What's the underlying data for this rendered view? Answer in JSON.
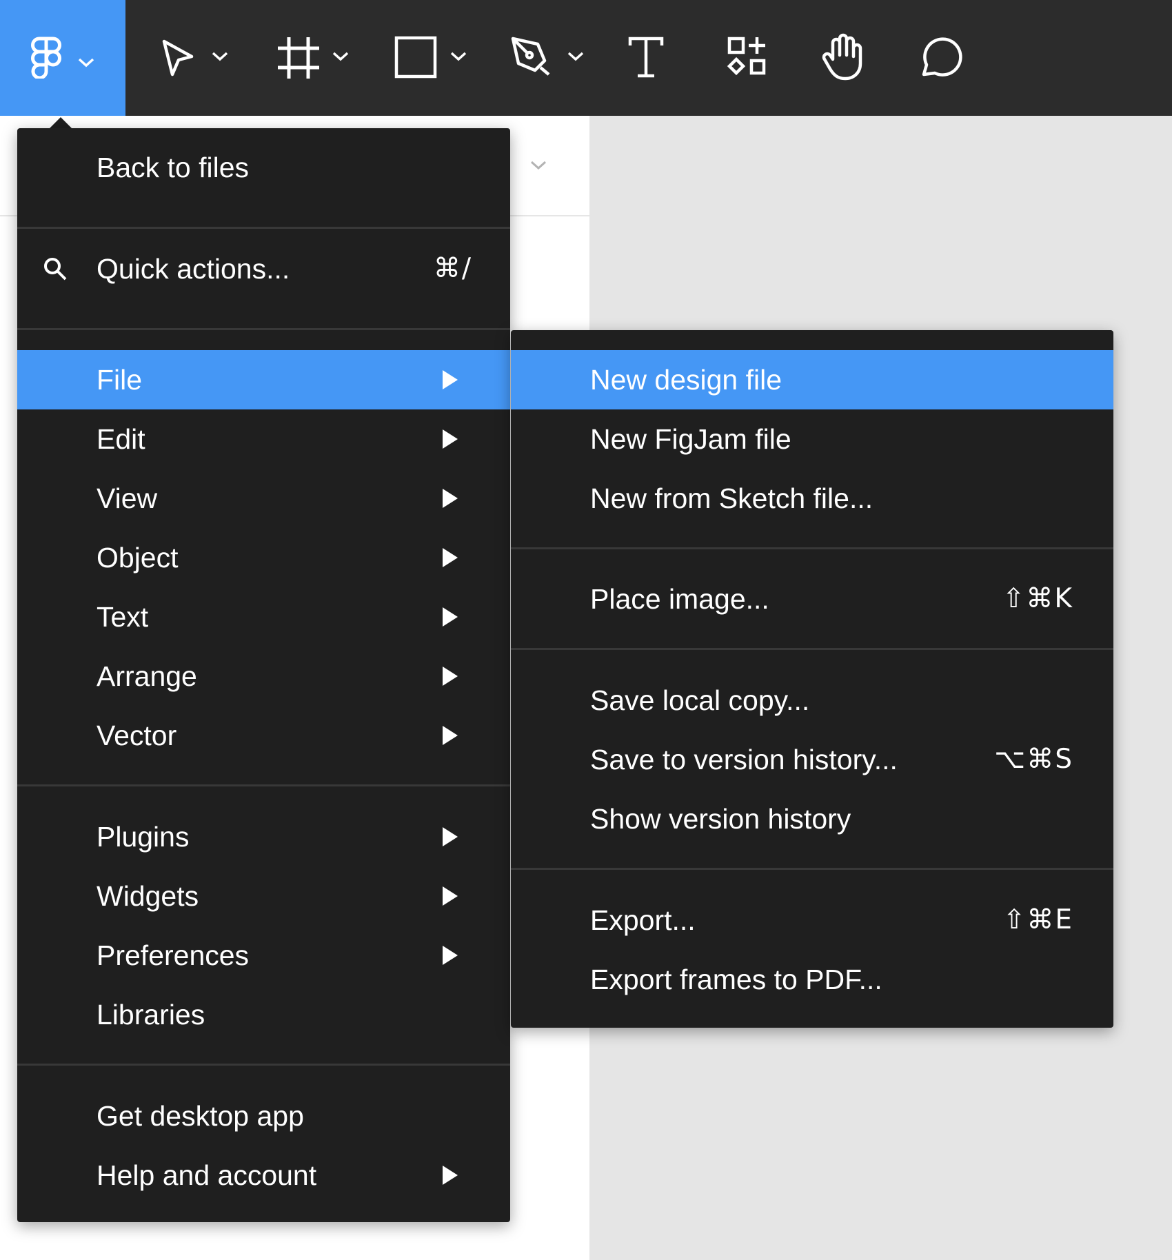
{
  "toolbar": {
    "tools": [
      {
        "icon": "figma-logo-icon",
        "has_dropdown": true,
        "active": true
      },
      {
        "icon": "move-tool-icon",
        "has_dropdown": true
      },
      {
        "icon": "frame-tool-icon",
        "has_dropdown": true
      },
      {
        "icon": "rectangle-tool-icon",
        "has_dropdown": true
      },
      {
        "icon": "pen-tool-icon",
        "has_dropdown": true
      },
      {
        "icon": "text-tool-icon"
      },
      {
        "icon": "resources-icon"
      },
      {
        "icon": "hand-tool-icon"
      },
      {
        "icon": "comment-tool-icon"
      }
    ]
  },
  "colors": {
    "toolbar_bg": "#2c2c2c",
    "accent": "#4597f5",
    "menu_bg": "#1f1f1f",
    "canvas_bg": "#e5e5e5",
    "panel_bg": "#ffffff"
  },
  "main_menu": {
    "back": "Back to files",
    "quick_actions": {
      "label": "Quick actions...",
      "shortcut": "⌘/"
    },
    "items": [
      {
        "label": "File",
        "submenu": true,
        "active": true
      },
      {
        "label": "Edit",
        "submenu": true
      },
      {
        "label": "View",
        "submenu": true
      },
      {
        "label": "Object",
        "submenu": true
      },
      {
        "label": "Text",
        "submenu": true
      },
      {
        "label": "Arrange",
        "submenu": true
      },
      {
        "label": "Vector",
        "submenu": true
      },
      {
        "label": "Plugins",
        "submenu": true
      },
      {
        "label": "Widgets",
        "submenu": true
      },
      {
        "label": "Preferences",
        "submenu": true
      },
      {
        "label": "Libraries",
        "submenu": false
      },
      {
        "label": "Get desktop app",
        "submenu": false
      },
      {
        "label": "Help and account",
        "submenu": true
      }
    ]
  },
  "file_menu": {
    "items": [
      {
        "label": "New design file",
        "active": true
      },
      {
        "label": "New FigJam file"
      },
      {
        "label": "New from Sketch file..."
      },
      {
        "label": "Place image...",
        "shortcut": "⇧⌘K"
      },
      {
        "label": "Save local copy..."
      },
      {
        "label": "Save to version history...",
        "shortcut": "⌥⌘S"
      },
      {
        "label": "Show version history"
      },
      {
        "label": "Export...",
        "shortcut": "⇧⌘E"
      },
      {
        "label": "Export frames to PDF..."
      }
    ]
  }
}
